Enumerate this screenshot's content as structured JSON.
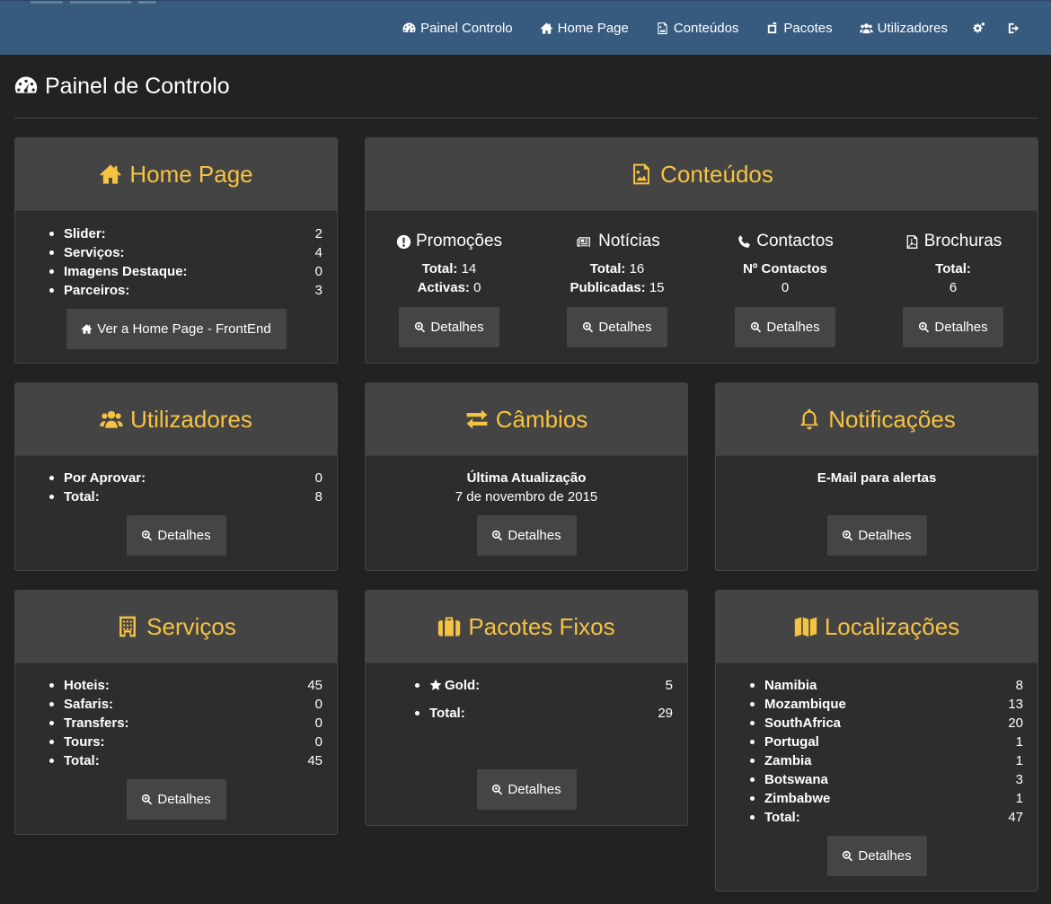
{
  "nav": {
    "items": [
      {
        "label": "Painel Controlo",
        "icon": "dashboard-icon"
      },
      {
        "label": "Home Page",
        "icon": "home-icon"
      },
      {
        "label": "Conteúdos",
        "icon": "image-icon"
      },
      {
        "label": "Pacotes",
        "icon": "package-icon"
      },
      {
        "label": "Utilizadores",
        "icon": "users-icon"
      }
    ],
    "settings_icon": "gears-icon",
    "logout_icon": "sign-out-icon"
  },
  "page": {
    "title": "Painel de Controlo"
  },
  "colors": {
    "accent": "#f5c242",
    "navbar": "#375a7f",
    "background": "#222222",
    "panel": "#2d2d2d",
    "panel_head": "#444444",
    "button": "#464545"
  },
  "home": {
    "title": "Home Page",
    "rows": [
      {
        "label": "Slider:",
        "value": "2"
      },
      {
        "label": "Serviços:",
        "value": "4"
      },
      {
        "label": "Imagens Destaque:",
        "value": "0"
      },
      {
        "label": "Parceiros:",
        "value": "3"
      }
    ],
    "button": "Ver a Home Page - FrontEnd"
  },
  "conteudos": {
    "title": "Conteúdos",
    "promocoes": {
      "title": "Promoções",
      "l1": "Total:",
      "v1": "14",
      "l2": "Activas:",
      "v2": "0",
      "button": "Detalhes"
    },
    "noticias": {
      "title": "Notícias",
      "l1": "Total:",
      "v1": "16",
      "l2": "Publicadas:",
      "v2": "15",
      "button": "Detalhes"
    },
    "contactos": {
      "title": "Contactos",
      "l1": "Nº Contactos",
      "v1": "0",
      "button": "Detalhes"
    },
    "brochuras": {
      "title": "Brochuras",
      "l1": "Total:",
      "v1": "6",
      "button": "Detalhes"
    }
  },
  "utilizadores": {
    "title": "Utilizadores",
    "rows": [
      {
        "label": "Por Aprovar:",
        "value": "0"
      },
      {
        "label": "Total:",
        "value": "8"
      }
    ],
    "button": "Detalhes"
  },
  "cambios": {
    "title": "Câmbios",
    "label": "Última Atualização",
    "date": "7 de novembro de 2015",
    "button": "Detalhes"
  },
  "notificacoes": {
    "title": "Notificações",
    "label": "E-Mail para alertas",
    "button": "Detalhes"
  },
  "servicos": {
    "title": "Serviços",
    "rows": [
      {
        "label": "Hoteis:",
        "value": "45"
      },
      {
        "label": "Safaris:",
        "value": "0"
      },
      {
        "label": "Transfers:",
        "value": "0"
      },
      {
        "label": "Tours:",
        "value": "0"
      },
      {
        "label": "Total:",
        "value": "45"
      }
    ],
    "button": "Detalhes"
  },
  "pacotes": {
    "title": "Pacotes Fixos",
    "gold_label": "Gold:",
    "gold_value": "5",
    "total_label": "Total:",
    "total_value": "29",
    "button": "Detalhes"
  },
  "localizacoes": {
    "title": "Localizações",
    "rows": [
      {
        "label": "Namibia",
        "value": "8"
      },
      {
        "label": "Mozambique",
        "value": "13"
      },
      {
        "label": "SouthAfrica",
        "value": "20"
      },
      {
        "label": "Portugal",
        "value": "1"
      },
      {
        "label": "Zambia",
        "value": "1"
      },
      {
        "label": "Botswana",
        "value": "3"
      },
      {
        "label": "Zimbabwe",
        "value": "1"
      },
      {
        "label": "Total:",
        "value": "47"
      }
    ],
    "button": "Detalhes"
  }
}
